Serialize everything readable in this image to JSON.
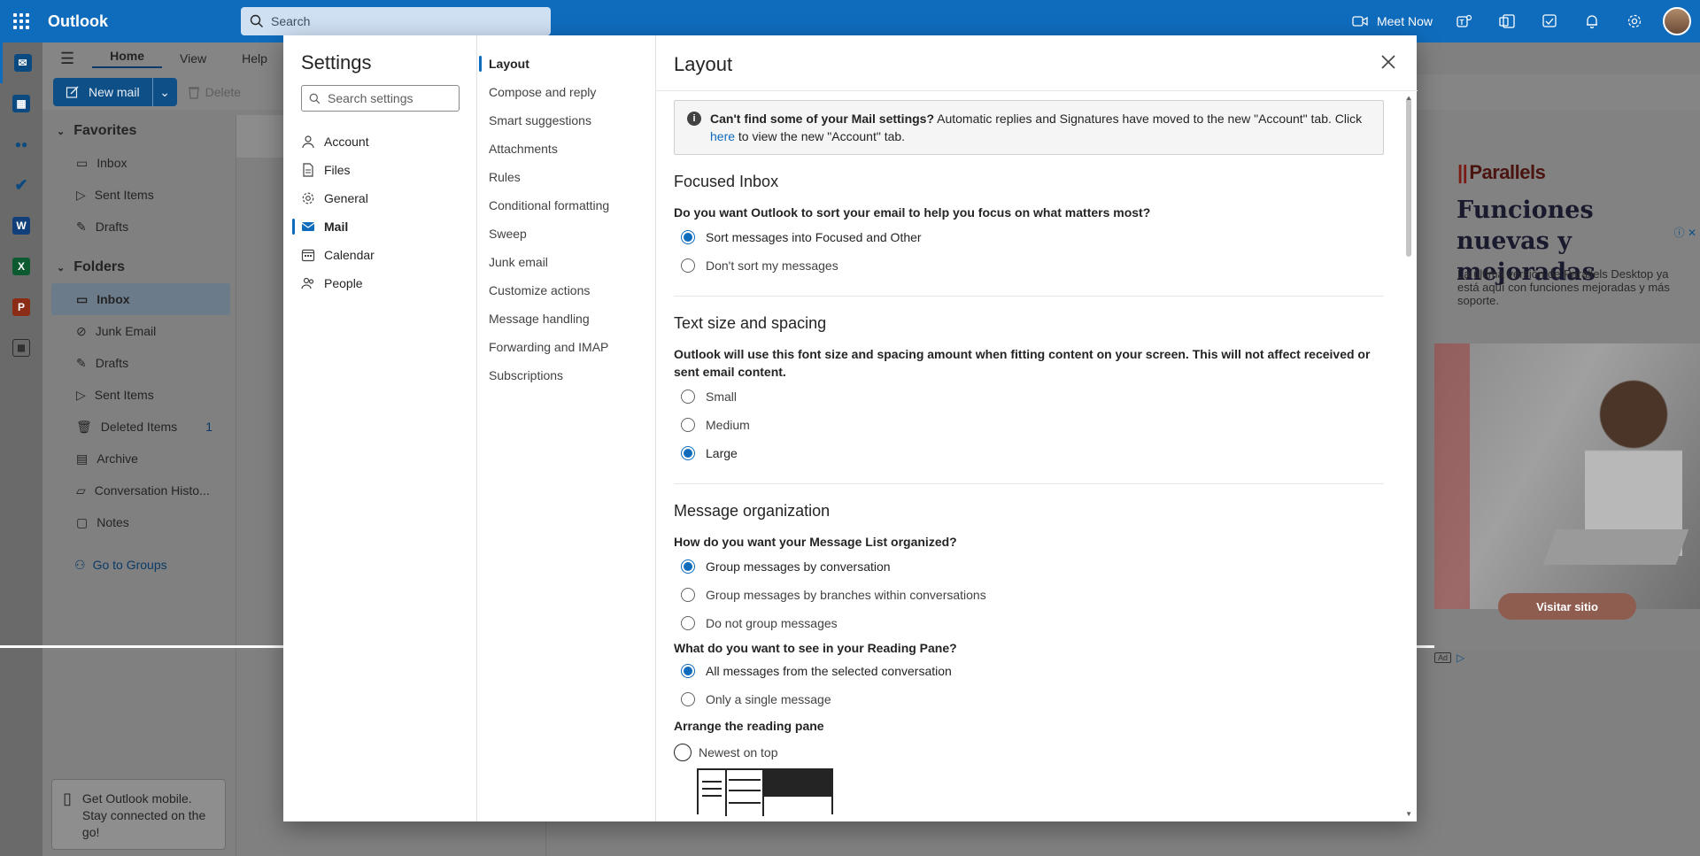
{
  "app": {
    "title": "Outlook"
  },
  "search": {
    "placeholder": "Search"
  },
  "topbar": {
    "meet_now": "Meet Now"
  },
  "ribbon": {
    "tabs": [
      "Home",
      "View",
      "Help"
    ],
    "new_mail": "New mail",
    "delete": "Delete"
  },
  "favorites": {
    "title": "Favorites",
    "items": [
      "Inbox",
      "Sent Items",
      "Drafts"
    ]
  },
  "folders": {
    "title": "Folders",
    "items": [
      {
        "label": "Inbox",
        "count": ""
      },
      {
        "label": "Junk Email",
        "count": ""
      },
      {
        "label": "Drafts",
        "count": ""
      },
      {
        "label": "Sent Items",
        "count": ""
      },
      {
        "label": "Deleted Items",
        "count": "1"
      },
      {
        "label": "Archive",
        "count": ""
      },
      {
        "label": "Conversation Histo...",
        "count": ""
      },
      {
        "label": "Notes",
        "count": ""
      }
    ],
    "go_to_groups": "Go to Groups"
  },
  "mobile_card": {
    "text": "Get Outlook mobile. Stay connected on the go!"
  },
  "ad": {
    "brand": "Parallels",
    "headline": "Funciones nuevas y mejoradas",
    "sub": "La última versión de Parallels Desktop ya está aquí con funciones mejoradas y más soporte.",
    "button": "Visitar sitio",
    "badge": "Ad"
  },
  "settings": {
    "title": "Settings",
    "search_placeholder": "Search settings",
    "nav": [
      "Account",
      "Files",
      "General",
      "Mail",
      "Calendar",
      "People"
    ],
    "selected_nav": "Mail",
    "subnav": [
      "Layout",
      "Compose and reply",
      "Smart suggestions",
      "Attachments",
      "Rules",
      "Conditional formatting",
      "Sweep",
      "Junk email",
      "Customize actions",
      "Message handling",
      "Forwarding and IMAP",
      "Subscriptions"
    ],
    "selected_subnav": "Layout",
    "content_title": "Layout",
    "notice": {
      "bold": "Can't find some of your Mail settings?",
      "text": " Automatic replies and Signatures have moved to the new \"Account\" tab. Click ",
      "link": "here",
      "tail": " to view the new \"Account\" tab."
    },
    "focused_inbox": {
      "title": "Focused Inbox",
      "question": "Do you want Outlook to sort your email to help you focus on what matters most?",
      "options": [
        "Sort messages into Focused and Other",
        "Don't sort my messages"
      ],
      "selected": 0
    },
    "text_size": {
      "title": "Text size and spacing",
      "question": "Outlook will use this font size and spacing amount when fitting content on your screen. This will not affect received or sent email content.",
      "options": [
        "Small",
        "Medium",
        "Large"
      ],
      "selected": 2
    },
    "message_org": {
      "title": "Message organization",
      "question": "How do you want your Message List organized?",
      "options": [
        "Group messages by conversation",
        "Group messages by branches within conversations",
        "Do not group messages"
      ],
      "selected": 0
    },
    "reading_pane": {
      "question": "What do you want to see in your Reading Pane?",
      "options": [
        "All messages from the selected conversation",
        "Only a single message"
      ],
      "selected": 0
    },
    "arrange": {
      "question": "Arrange the reading pane",
      "options": [
        "Newest on top"
      ]
    }
  }
}
